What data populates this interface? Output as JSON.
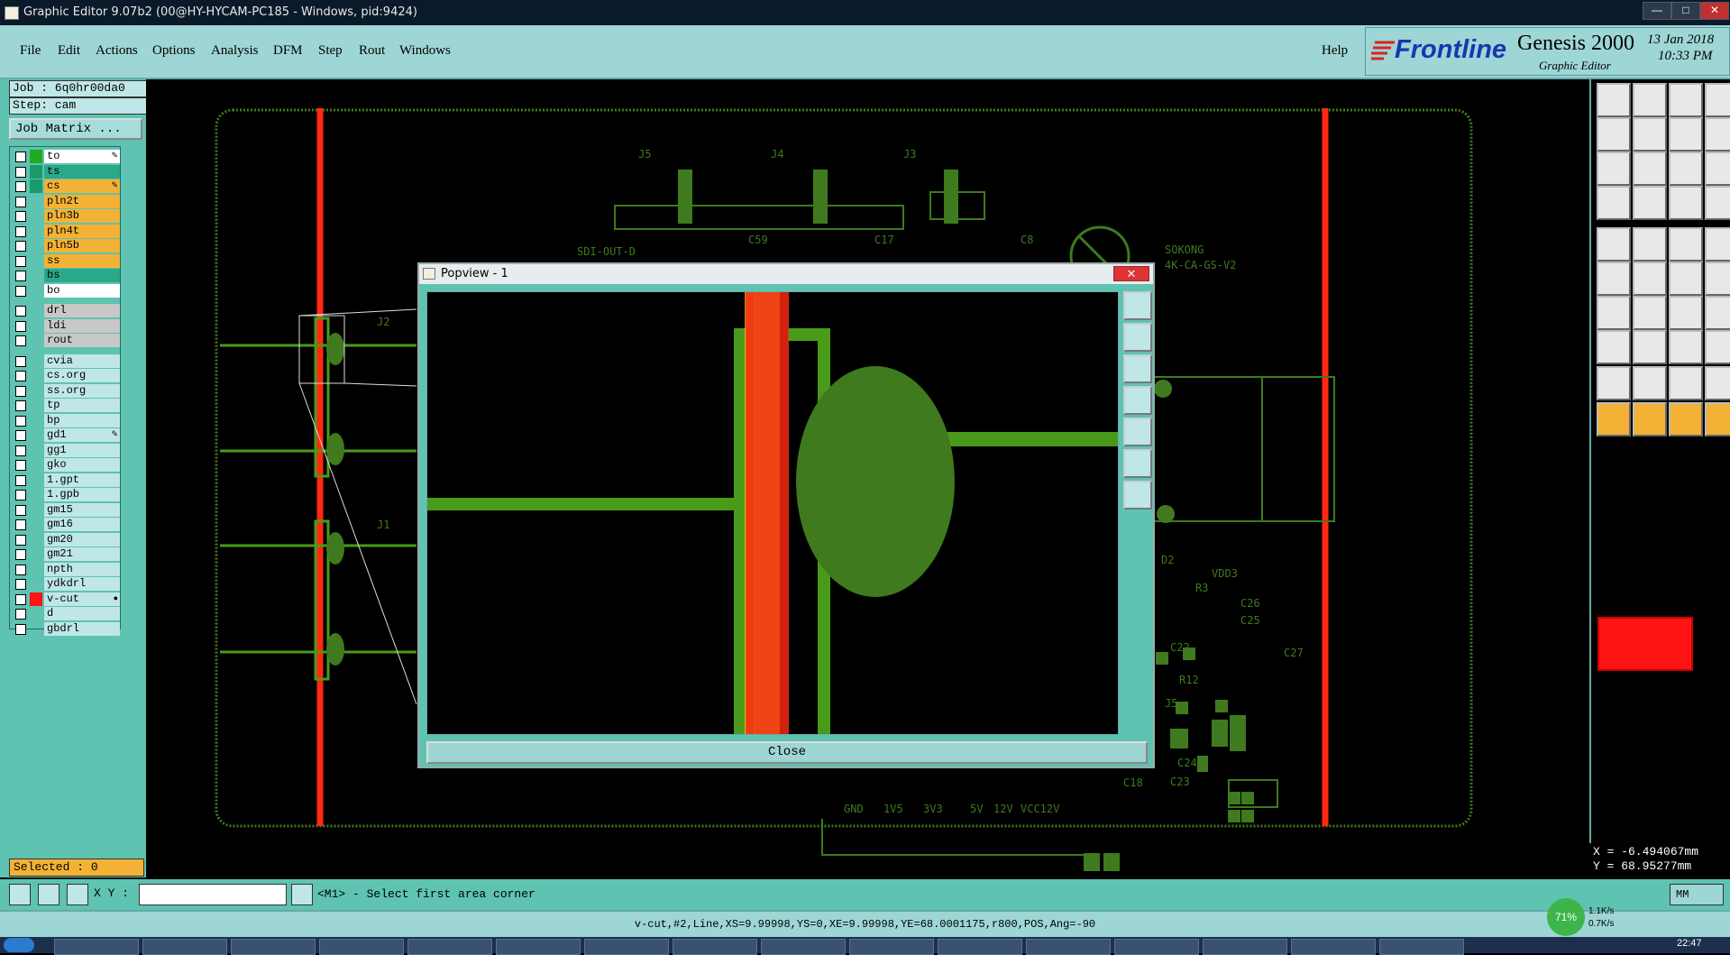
{
  "window": {
    "title": "Graphic Editor 9.07b2 (00@HY-HYCAM-PC185 - Windows, pid:9424)",
    "buttons": [
      "—",
      "□",
      "✕"
    ]
  },
  "menubar": {
    "items": [
      "File",
      "Edit",
      "Actions",
      "Options",
      "Analysis",
      "DFM",
      "Step",
      "Rout",
      "Windows"
    ],
    "help": "Help"
  },
  "logo": {
    "brand": "Frontline",
    "product": "Genesis 2000",
    "subtitle": "Graphic Editor",
    "date": "13 Jan 2018",
    "time": "10:33 PM"
  },
  "job": {
    "job_label": "Job : 6q0hr00da0",
    "step_label": "Step: cam",
    "job_matrix": "Job Matrix ..."
  },
  "layers": [
    {
      "name": "to",
      "swatch": "#22aa22",
      "bg": "#ffffff",
      "mark": "✎"
    },
    {
      "name": "ts",
      "swatch": "#1a9a6a",
      "bg": "#2aa88a",
      "mark": ""
    },
    {
      "name": "cs",
      "swatch": "#1a9a6a",
      "bg": "#f3b235",
      "mark": "✎"
    },
    {
      "name": "pln2t",
      "swatch": "",
      "bg": "#f3b235",
      "mark": ""
    },
    {
      "name": "pln3b",
      "swatch": "",
      "bg": "#f3b235",
      "mark": ""
    },
    {
      "name": "pln4t",
      "swatch": "",
      "bg": "#f3b235",
      "mark": ""
    },
    {
      "name": "pln5b",
      "swatch": "",
      "bg": "#f3b235",
      "mark": ""
    },
    {
      "name": "ss",
      "swatch": "",
      "bg": "#f3b235",
      "mark": ""
    },
    {
      "name": "bs",
      "swatch": "",
      "bg": "#2aa88a",
      "mark": ""
    },
    {
      "name": "bo",
      "swatch": "",
      "bg": "#ffffff",
      "mark": ""
    },
    {
      "name": "drl",
      "swatch": "",
      "bg": "#c8c8c8",
      "mark": ""
    },
    {
      "name": "ldi",
      "swatch": "",
      "bg": "#c8c8c8",
      "mark": ""
    },
    {
      "name": "rout",
      "swatch": "",
      "bg": "#c8c8c8",
      "mark": ""
    },
    {
      "name": "cvia",
      "swatch": "",
      "bg": "#bfe7e7",
      "mark": ""
    },
    {
      "name": "cs.org",
      "swatch": "",
      "bg": "#bfe7e7",
      "mark": ""
    },
    {
      "name": "ss.org",
      "swatch": "",
      "bg": "#bfe7e7",
      "mark": ""
    },
    {
      "name": "tp",
      "swatch": "",
      "bg": "#bfe7e7",
      "mark": ""
    },
    {
      "name": "bp",
      "swatch": "",
      "bg": "#bfe7e7",
      "mark": ""
    },
    {
      "name": "gd1",
      "swatch": "",
      "bg": "#bfe7e7",
      "mark": "✎"
    },
    {
      "name": "gg1",
      "swatch": "",
      "bg": "#bfe7e7",
      "mark": ""
    },
    {
      "name": "gko",
      "swatch": "",
      "bg": "#bfe7e7",
      "mark": ""
    },
    {
      "name": "1.gpt",
      "swatch": "",
      "bg": "#bfe7e7",
      "mark": ""
    },
    {
      "name": "1.gpb",
      "swatch": "",
      "bg": "#bfe7e7",
      "mark": ""
    },
    {
      "name": "gm15",
      "swatch": "",
      "bg": "#bfe7e7",
      "mark": ""
    },
    {
      "name": "gm16",
      "swatch": "",
      "bg": "#bfe7e7",
      "mark": ""
    },
    {
      "name": "gm20",
      "swatch": "",
      "bg": "#bfe7e7",
      "mark": ""
    },
    {
      "name": "gm21",
      "swatch": "",
      "bg": "#bfe7e7",
      "mark": ""
    },
    {
      "name": "npth",
      "swatch": "",
      "bg": "#bfe7e7",
      "mark": ""
    },
    {
      "name": "ydkdrl",
      "swatch": "",
      "bg": "#bfe7e7",
      "mark": ""
    },
    {
      "name": "v-cut",
      "swatch": "#ff1414",
      "bg": "#bfe7e7",
      "mark": "●"
    },
    {
      "name": "d",
      "swatch": "",
      "bg": "#bfe7e7",
      "mark": ""
    },
    {
      "name": "gbdrl",
      "swatch": "",
      "bg": "#bfe7e7",
      "mark": ""
    }
  ],
  "selected": "Selected : 0",
  "xy_label": "X Y :",
  "xy_value": "",
  "prompt": "<M1> - Select first area corner",
  "status": "v-cut,#2,Line,XS=9.99998,YS=0,XE=9.99998,YE=68.0001175,r800,POS,Ang=-90",
  "coords": {
    "x": "X = -6.494067mm",
    "y": "Y = 68.95277mm"
  },
  "units": "MM",
  "network": {
    "percent": "71%",
    "up": "1.1K/s",
    "down": "0.7K/s"
  },
  "clock": "22:47",
  "popview": {
    "title": "Popview - 1",
    "close_label": "Close"
  },
  "board_labels": [
    "J5",
    "J4",
    "J3",
    "J2",
    "J1",
    "SDI-OUT-D",
    "SOKONG",
    "4K-CA-GS-V2",
    "VDD3",
    "R3",
    "C26",
    "C25",
    "C27",
    "C22",
    "R12",
    "D2",
    "C18",
    "C24",
    "C23",
    "GND",
    "1V5",
    "3V3",
    "5V",
    "12V",
    "VCC12V",
    "C8",
    "C17",
    "C59",
    "J5"
  ],
  "colors": {
    "accent_red": "#ff1414",
    "trace_green": "#4a9a1a",
    "panel": "#5ec3b1",
    "menu": "#9ed5d5"
  }
}
